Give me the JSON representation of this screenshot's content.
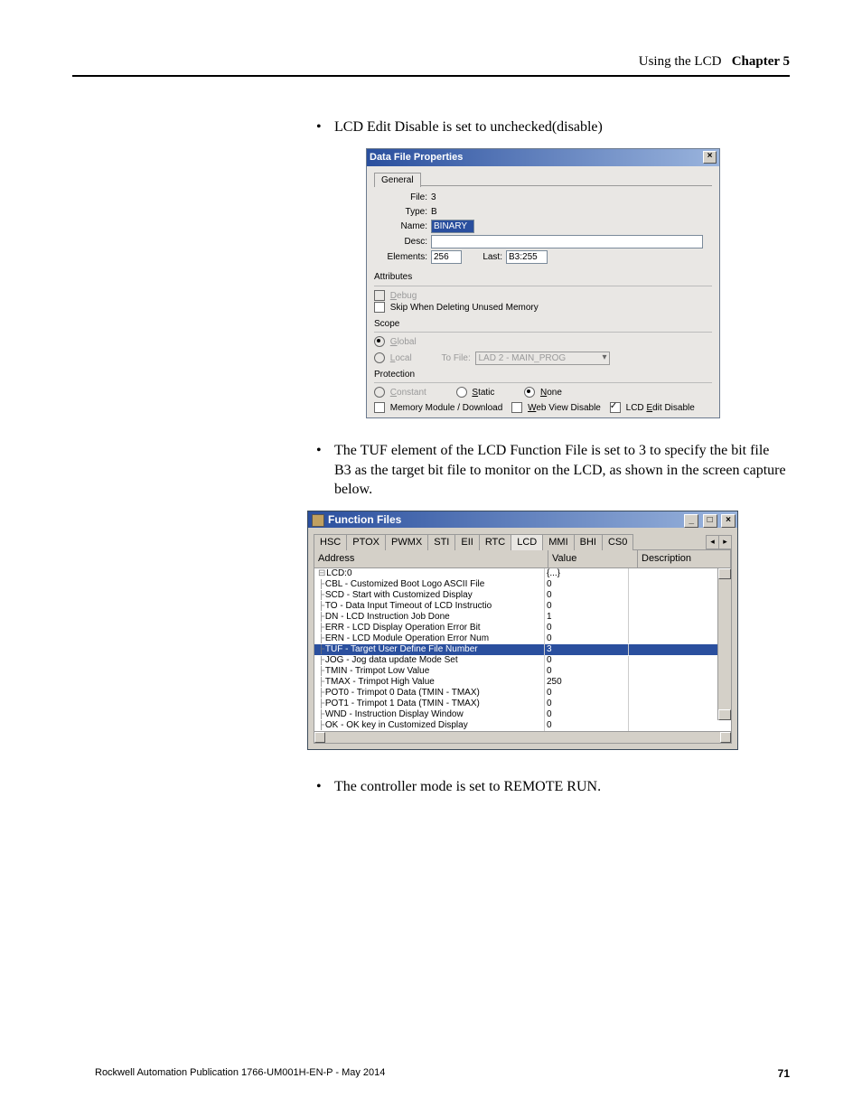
{
  "header": {
    "section": "Using the LCD",
    "chapter": "Chapter 5"
  },
  "bullets": {
    "b1": "LCD Edit Disable is set to unchecked(disable)",
    "b2": "The TUF element of the LCD Function File is set to 3 to specify the bit file B3 as the target bit file to monitor on the LCD, as shown in the screen capture below.",
    "b3": "The controller mode is set to REMOTE RUN."
  },
  "dlg1": {
    "title": "Data File Properties",
    "tab": "General",
    "fields": {
      "file_lbl": "File:",
      "file_val": "3",
      "type_lbl": "Type:",
      "type_val": "B",
      "name_lbl": "Name:",
      "name_val": "BINARY",
      "desc_lbl": "Desc:",
      "desc_val": "",
      "elements_lbl": "Elements:",
      "elements_val": "256",
      "last_lbl": "Last:",
      "last_val": "B3:255"
    },
    "attributes": {
      "heading": "Attributes",
      "debug": "Debug",
      "skip": "Skip When Deleting Unused Memory"
    },
    "scope": {
      "heading": "Scope",
      "global": "Global",
      "local": "Local",
      "tofile_lbl": "To File:",
      "tofile_val": "LAD 2 - MAIN_PROG"
    },
    "protection": {
      "heading": "Protection",
      "constant": "Constant",
      "static": "Static",
      "none": "None",
      "mem": "Memory Module / Download",
      "web": "Web View Disable",
      "lcd": "LCD Edit Disable"
    }
  },
  "ff": {
    "title": "Function Files",
    "tabs": [
      "HSC",
      "PTOX",
      "PWMX",
      "STI",
      "EII",
      "RTC",
      "LCD",
      "MMI",
      "BHI",
      "CS0"
    ],
    "active_tab": "LCD",
    "cols": {
      "c1": "Address",
      "c2": "Value",
      "c3": "Description"
    },
    "rows": [
      {
        "addr": "LCD:0",
        "val": "{...}",
        "pre": "⊟ "
      },
      {
        "addr": "CBL - Customized Boot Logo ASCII File",
        "val": "0",
        "pre": "├ "
      },
      {
        "addr": "SCD - Start with Customized Display",
        "val": "0",
        "pre": "├ "
      },
      {
        "addr": "TO - Data Input Timeout of LCD Instructio",
        "val": "0",
        "pre": "├ "
      },
      {
        "addr": "DN - LCD Instruction Job Done",
        "val": "1",
        "pre": "├ "
      },
      {
        "addr": "ERR - LCD Display Operation Error Bit",
        "val": "0",
        "pre": "├ "
      },
      {
        "addr": "ERN - LCD Module Operation Error Num",
        "val": "0",
        "pre": "├ "
      },
      {
        "addr": "TUF - Target User Define File Number",
        "val": "3",
        "pre": "├ ",
        "hl": true
      },
      {
        "addr": "JOG - Jog data update Mode Set",
        "val": "0",
        "pre": "├ "
      },
      {
        "addr": "TMIN - Trimpot Low Value",
        "val": "0",
        "pre": "├ "
      },
      {
        "addr": "TMAX - Trimpot High Value",
        "val": "250",
        "pre": "├ "
      },
      {
        "addr": "POT0 - Trimpot 0 Data (TMIN - TMAX)",
        "val": "0",
        "pre": "├ "
      },
      {
        "addr": "POT1 - Trimpot 1 Data (TMIN - TMAX)",
        "val": "0",
        "pre": "├ "
      },
      {
        "addr": "WND - Instruction Display Window",
        "val": "0",
        "pre": "├ "
      },
      {
        "addr": "OK - OK key in Customized Display",
        "val": "0",
        "pre": "├ "
      }
    ]
  },
  "footer": {
    "pub": "Rockwell Automation Publication 1766-UM001H-EN-P - May 2014",
    "page": "71"
  }
}
